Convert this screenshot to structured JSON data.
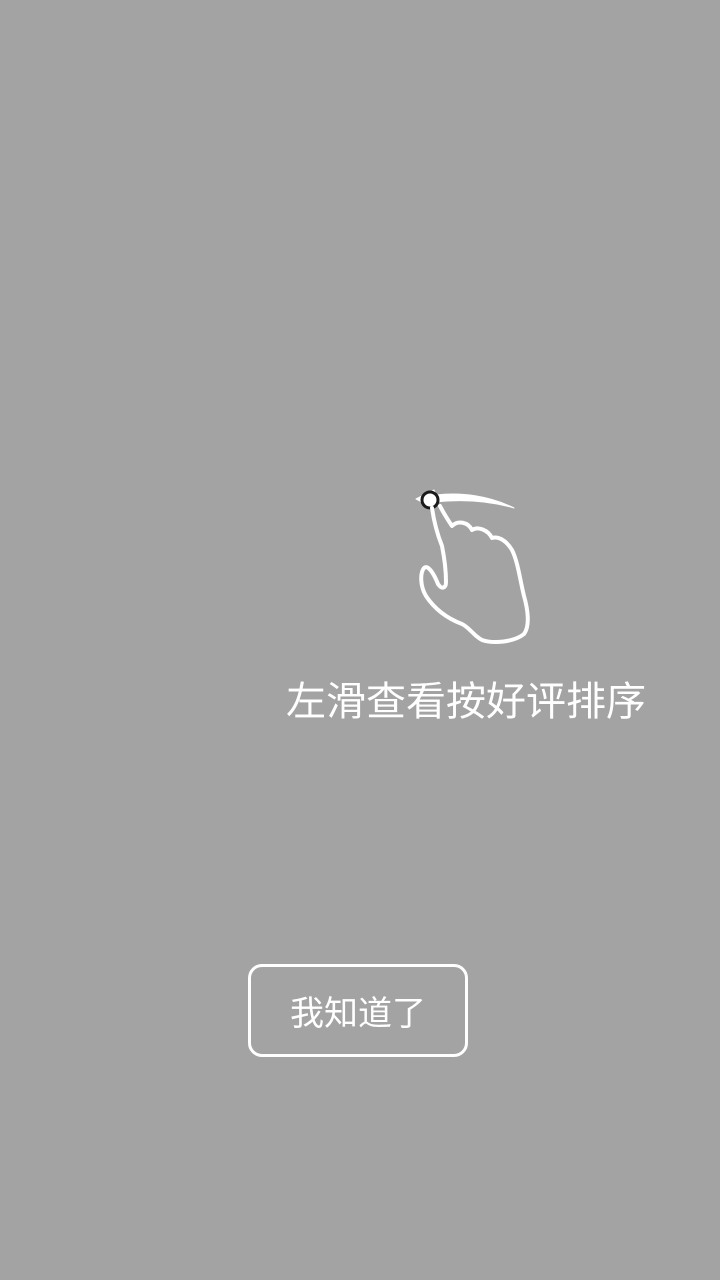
{
  "overlay": {
    "background_color": "#a3a3a3",
    "foreground_color": "#ffffff"
  },
  "guide": {
    "icon": "swipe-left-hand-icon",
    "hint_text": "左滑查看按好评排序"
  },
  "actions": {
    "confirm_label": "我知道了"
  }
}
